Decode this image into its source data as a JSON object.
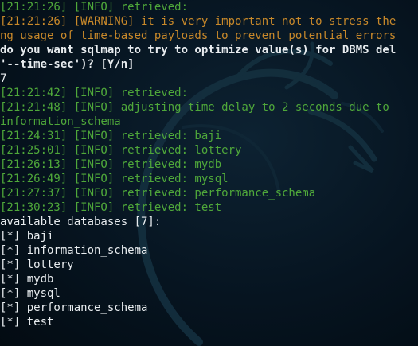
{
  "terminal": {
    "lines": [
      {
        "text": "[21:21:26] [INFO] retrieved:",
        "color": "#4fa83a"
      },
      {
        "text": "[21:21:26] [WARNING] it is very important not to stress the",
        "color": "#c9892a"
      },
      {
        "text": "ng usage of time-based payloads to prevent potential errors",
        "color": "#c9892a"
      },
      {
        "text": "do you want sqlmap to try to optimize value(s) for DBMS del",
        "color": "#e8ecef"
      },
      {
        "text": "'--time-sec')? [Y/n]",
        "color": "#e8ecef"
      },
      {
        "text": "7",
        "color": "#e8ecef"
      },
      {
        "text": "[21:21:42] [INFO] retrieved:",
        "color": "#4fa83a"
      },
      {
        "text": "[21:21:48] [INFO] adjusting time delay to 2 seconds due to",
        "color": "#4fa83a"
      },
      {
        "text": "information_schema",
        "color": "#4fa83a"
      },
      {
        "text": "[21:24:31] [INFO] retrieved: baji",
        "color": "#4fa83a"
      },
      {
        "text": "[21:25:01] [INFO] retrieved: lottery",
        "color": "#4fa83a"
      },
      {
        "text": "[21:26:13] [INFO] retrieved: mydb",
        "color": "#4fa83a"
      },
      {
        "text": "[21:26:49] [INFO] retrieved: mysql",
        "color": "#4fa83a"
      },
      {
        "text": "[21:27:37] [INFO] retrieved: performance_schema",
        "color": "#4fa83a"
      },
      {
        "text": "[21:30:23] [INFO] retrieved: test",
        "color": "#4fa83a"
      },
      {
        "text": "available databases [7]:",
        "color": "#e8ecef"
      },
      {
        "text": "[*] baji",
        "color": "#e8ecef"
      },
      {
        "text": "[*] information_schema",
        "color": "#e8ecef"
      },
      {
        "text": "[*] lottery",
        "color": "#e8ecef"
      },
      {
        "text": "[*] mydb",
        "color": "#e8ecef"
      },
      {
        "text": "[*] mysql",
        "color": "#e8ecef"
      },
      {
        "text": "[*] performance_schema",
        "color": "#e8ecef"
      },
      {
        "text": "[*] test",
        "color": "#e8ecef"
      }
    ]
  },
  "colors": {
    "background": "#061420",
    "info": "#4fa83a",
    "warning": "#c9892a",
    "output": "#e8ecef"
  },
  "icons": {
    "background_logo": "kali-dragon-icon"
  }
}
